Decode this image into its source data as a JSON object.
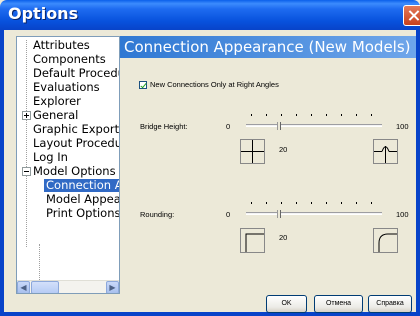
{
  "window": {
    "title": "Options"
  },
  "tree": {
    "items": [
      {
        "label": "Attributes"
      },
      {
        "label": "Components"
      },
      {
        "label": "Default Procedu"
      },
      {
        "label": "Evaluations"
      },
      {
        "label": "Explorer"
      },
      {
        "label": "General"
      },
      {
        "label": "Graphic Export"
      },
      {
        "label": "Layout Procedu"
      },
      {
        "label": "Log In"
      },
      {
        "label": "Model Options ("
      },
      {
        "label": "Connection A"
      },
      {
        "label": "Model Appea"
      },
      {
        "label": "Print Options"
      }
    ],
    "selected": "Connection A"
  },
  "panel": {
    "header": "Connection Appearance (New Models)",
    "checkbox_label": "New Connections Only at Right Angles",
    "checkbox_checked": true,
    "bridge": {
      "label": "Bridge Height:",
      "min": "0",
      "max": "100",
      "value": "20",
      "fraction": 0.2
    },
    "rounding": {
      "label": "Rounding:",
      "min": "0",
      "max": "100",
      "value": "20",
      "fraction": 0.2
    }
  },
  "buttons": {
    "ok": "OK",
    "cancel": "Отмена",
    "help": "Справка"
  }
}
